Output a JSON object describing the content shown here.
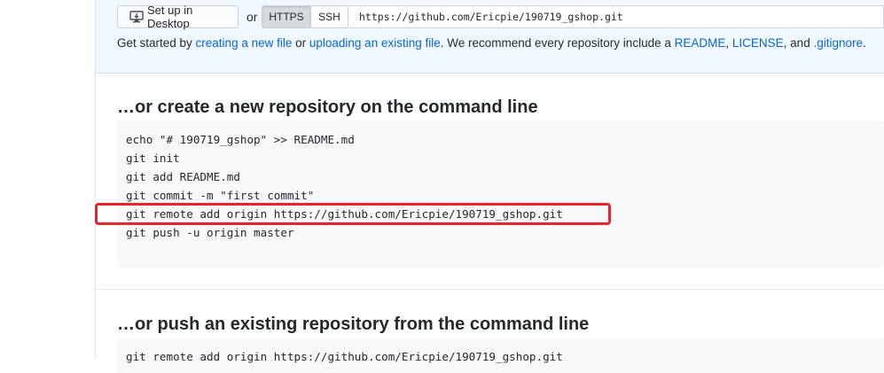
{
  "quick_setup": {
    "desktop_button_label": "Set up in Desktop",
    "or_label": "or",
    "https_label": "HTTPS",
    "ssh_label": "SSH",
    "repo_url": "https://github.com/Ericpie/190719_gshop.git",
    "help": {
      "prefix": "Get started by ",
      "link_new_file": "creating a new file",
      "or": " or ",
      "link_upload": "uploading an existing file",
      "middle": ". We recommend every repository include a ",
      "link_readme": "README",
      "comma": ", ",
      "link_license": "LICENSE",
      "and": ", and ",
      "link_gitignore": ".gitignore",
      "suffix": "."
    }
  },
  "new_repo": {
    "title": "…or create a new repository on the command line",
    "lines": [
      "echo \"# 190719_gshop\" >> README.md",
      "git init",
      "git add README.md",
      "git commit -m \"first commit\"",
      "git remote add origin https://github.com/Ericpie/190719_gshop.git",
      "git push -u origin master"
    ],
    "highlight_color": "#e8242c"
  },
  "push_existing": {
    "title": "…or push an existing repository from the command line",
    "lines": [
      "git remote add origin https://github.com/Ericpie/190719_gshop.git"
    ]
  }
}
